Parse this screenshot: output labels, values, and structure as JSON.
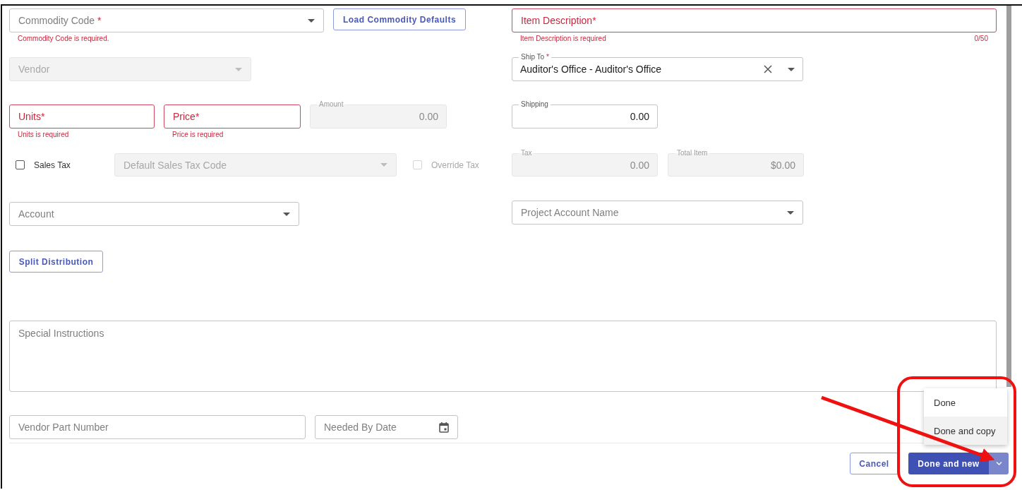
{
  "commodity_code": {
    "label": "Commodity Code",
    "required_mark": "*",
    "error": "Commodity Code is required.",
    "invalid": false,
    "disabled": false
  },
  "load_defaults_button": "Load Commodity Defaults",
  "item_description": {
    "label": "Item Description*",
    "error": "Item Description is required",
    "counter": "0/50",
    "invalid": true,
    "disabled": false
  },
  "vendor": {
    "label": "Vendor",
    "invalid": false,
    "disabled": true
  },
  "ship_to": {
    "label": "Ship To",
    "required_mark": "*",
    "value": "Auditor's Office - Auditor's Office",
    "clearable": true,
    "invalid": false,
    "disabled": false
  },
  "units": {
    "label": "Units*",
    "error": "Units is required",
    "invalid": true,
    "disabled": false
  },
  "price": {
    "label": "Price*",
    "error": "Price is required",
    "invalid": true,
    "disabled": false
  },
  "amount": {
    "label": "Amount",
    "value": "0.00",
    "invalid": false,
    "disabled": true
  },
  "shipping": {
    "label": "Shipping",
    "value": "0.00",
    "invalid": false,
    "disabled": false
  },
  "sales_tax": {
    "label": "Sales Tax",
    "checked": false,
    "disabled": false
  },
  "sales_tax_code": {
    "label": "Default Sales Tax Code",
    "invalid": false,
    "disabled": true
  },
  "override_tax": {
    "label": "Override Tax",
    "checked": false,
    "disabled": true
  },
  "tax": {
    "label": "Tax",
    "value": "0.00",
    "invalid": false,
    "disabled": true
  },
  "total_item": {
    "label": "Total Item",
    "value": "$0.00",
    "invalid": false,
    "disabled": true
  },
  "account": {
    "label": "Account",
    "invalid": false,
    "disabled": false
  },
  "project_account": {
    "label": "Project Account Name",
    "invalid": false,
    "disabled": false
  },
  "split_distribution_button": "Split Distribution",
  "special_instructions": {
    "placeholder": "Special Instructions"
  },
  "vendor_part_number": {
    "placeholder": "Vendor Part Number"
  },
  "needed_by_date": {
    "placeholder": "Needed By Date"
  },
  "footer": {
    "cancel": "Cancel",
    "primary": "Done and new"
  },
  "menu": {
    "items": [
      {
        "label": "Done",
        "selected": false
      },
      {
        "label": "Done and copy",
        "selected": true
      }
    ]
  }
}
